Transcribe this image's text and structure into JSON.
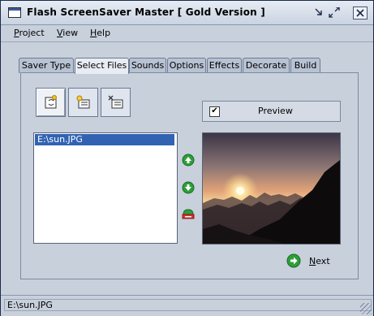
{
  "window": {
    "title": "Flash ScreenSaver Master [ Gold Version ]",
    "app_icon": "window-icon",
    "controls": [
      "minimize-icon",
      "restore-icon",
      "close-icon"
    ]
  },
  "menubar": {
    "items": [
      {
        "label": "Project",
        "accel": "P",
        "rest": "roject"
      },
      {
        "label": "View",
        "accel": "V",
        "rest": "iew"
      },
      {
        "label": "Help",
        "accel": "H",
        "rest": "elp"
      }
    ]
  },
  "tabs": {
    "items": [
      "Saver Type",
      "Select Files",
      "Sounds",
      "Options",
      "Effects",
      "Decorate",
      "Build"
    ],
    "active": "Select Files"
  },
  "toolbar": {
    "buttons": [
      "add-files-icon",
      "add-file-icon",
      "remove-file-icon"
    ]
  },
  "file_list": {
    "items": [
      "E:\\sun.JPG"
    ],
    "selected": "E:\\sun.JPG"
  },
  "side_buttons": [
    "move-up-icon",
    "move-down-icon",
    "remove-icon"
  ],
  "preview": {
    "label": "Preview",
    "checked": true,
    "check_glyph": "✔"
  },
  "next": {
    "label": "Next",
    "accel": "N",
    "rest": "ext"
  },
  "status": {
    "text": "E:\\sun.JPG"
  }
}
